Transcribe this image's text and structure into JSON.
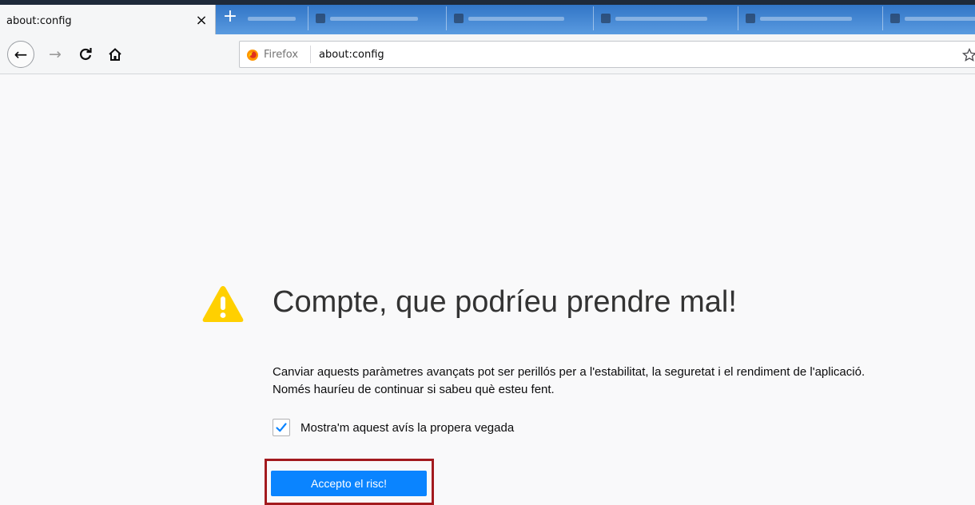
{
  "tabs": {
    "active_title": "about:config",
    "close_glyph": "×",
    "new_tab_glyph": "+"
  },
  "navbar": {
    "back_glyph": "←",
    "forward_glyph": "→",
    "identity_label": "Firefox",
    "url": "about:config"
  },
  "warning": {
    "title": "Compte, que podríeu prendre mal!",
    "description_line1": "Canviar aquests paràmetres avançats pot ser perillós per a l'estabilitat, la seguretat i el rendiment de l'aplicació.",
    "description_line2": "Només hauríeu de continuar si sabeu què esteu fent.",
    "checkbox_label": "Mostra'm aquest avís la propera vegada",
    "checkbox_checked": true,
    "accept_button_label": "Accepto el risc!"
  },
  "colors": {
    "accent": "#0a84ff",
    "warning_yellow": "#ffd000",
    "highlight_border": "#a31a1e"
  },
  "icons": [
    "close-icon",
    "plus-icon",
    "back-arrow-icon",
    "forward-arrow-icon",
    "reload-icon",
    "home-icon",
    "firefox-logo-icon",
    "bookmark-star-icon",
    "warning-triangle-icon",
    "checkmark-icon"
  ]
}
